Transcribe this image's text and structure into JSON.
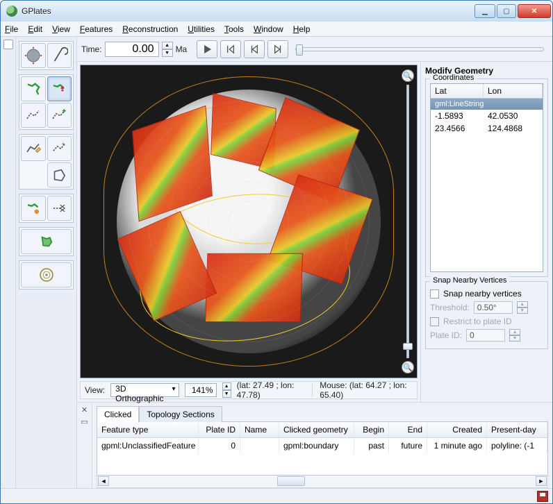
{
  "window": {
    "title": "GPlates"
  },
  "menu": [
    "File",
    "Edit",
    "View",
    "Features",
    "Reconstruction",
    "Utilities",
    "Tools",
    "Window",
    "Help"
  ],
  "time": {
    "label": "Time:",
    "value": "0.00",
    "unit": "Ma"
  },
  "viewbar": {
    "label": "View:",
    "projection": "3D Orthographic",
    "zoom": "141%",
    "cursor": "(lat: 27.49 ; lon: 47.78)",
    "mouse": "Mouse: (lat: 64.27 ; lon: 65.40)"
  },
  "right": {
    "title": "Modify Geometry",
    "coords": {
      "legend": "Coordinates",
      "headers": {
        "lat": "Lat",
        "lon": "Lon"
      },
      "type": "gml:LineString",
      "rows": [
        {
          "lat": "-1.5893",
          "lon": "42.0530"
        },
        {
          "lat": "23.4566",
          "lon": "124.4868"
        }
      ]
    },
    "snap": {
      "legend": "Snap Nearby Vertices",
      "checkbox": "Snap nearby vertices",
      "threshold_label": "Threshold:",
      "threshold_value": "0.50°",
      "restrict": "Restrict to plate ID",
      "plateid_label": "Plate ID:",
      "plateid_value": "0"
    }
  },
  "bottom": {
    "tabs": [
      "Clicked",
      "Topology Sections"
    ],
    "headers": [
      "Feature type",
      "Plate ID",
      "Name",
      "Clicked geometry",
      "Begin",
      "End",
      "Created",
      "Present-day"
    ],
    "row": [
      "gpml:UnclassifiedFeature",
      "0",
      "",
      "gpml:boundary",
      "past",
      "future",
      "1 minute ago",
      "polyline: (-1"
    ]
  }
}
